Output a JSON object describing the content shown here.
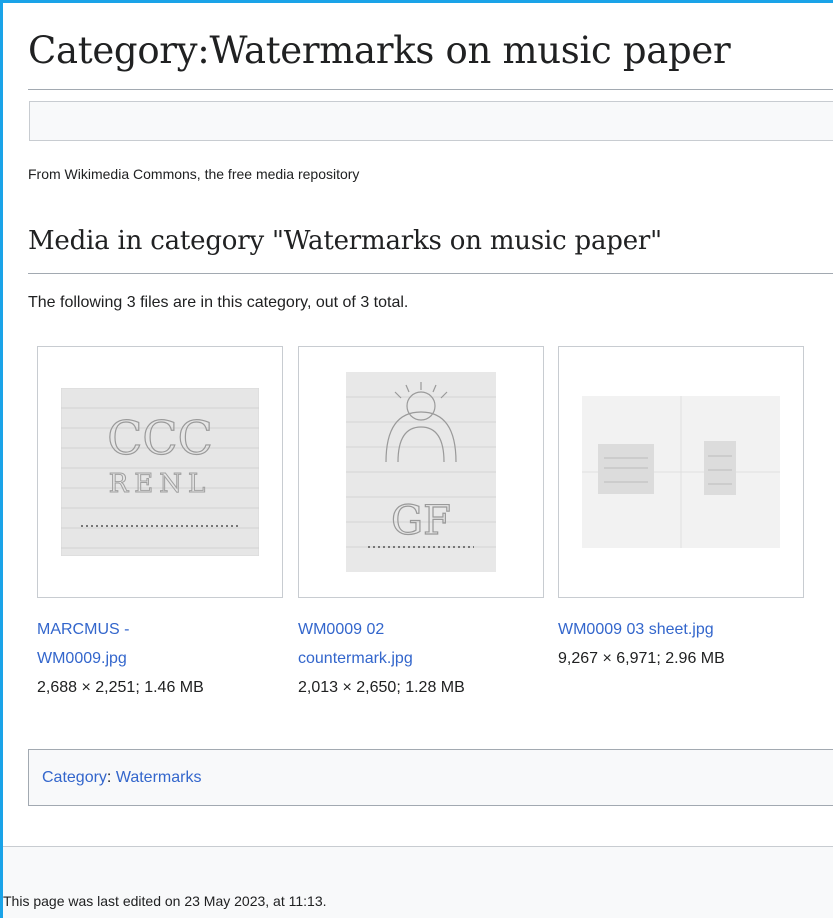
{
  "page": {
    "title": "Category:Watermarks on music paper",
    "tagline": "From Wikimedia Commons, the free media repository"
  },
  "media": {
    "heading": "Media in category \"Watermarks on music paper\"",
    "count_text": "The following 3 files are in this category, out of 3 total.",
    "items": [
      {
        "name_line1": "MARCMUS -",
        "name_line2": "WM0009.jpg",
        "meta": "2,688 × 2,251; 1.46 MB",
        "thumb_text": "RENL",
        "thumb_glyphs": "CCC"
      },
      {
        "name_line1": "WM0009 02",
        "name_line2": "countermark.jpg",
        "meta": "2,013 × 2,650; 1.28 MB",
        "thumb_text": "GF"
      },
      {
        "name_line1": "WM0009 03 sheet.jpg",
        "name_line2": "",
        "meta": "9,267 × 6,971; 2.96 MB"
      }
    ]
  },
  "categories": {
    "label": "Category",
    "separator": ": ",
    "items": [
      "Watermarks"
    ]
  },
  "footer": {
    "last_edited": "This page was last edited on 23 May 2023, at 11:13."
  },
  "colors": {
    "frame_border": "#1aa3e8",
    "link": "#3366cc"
  }
}
